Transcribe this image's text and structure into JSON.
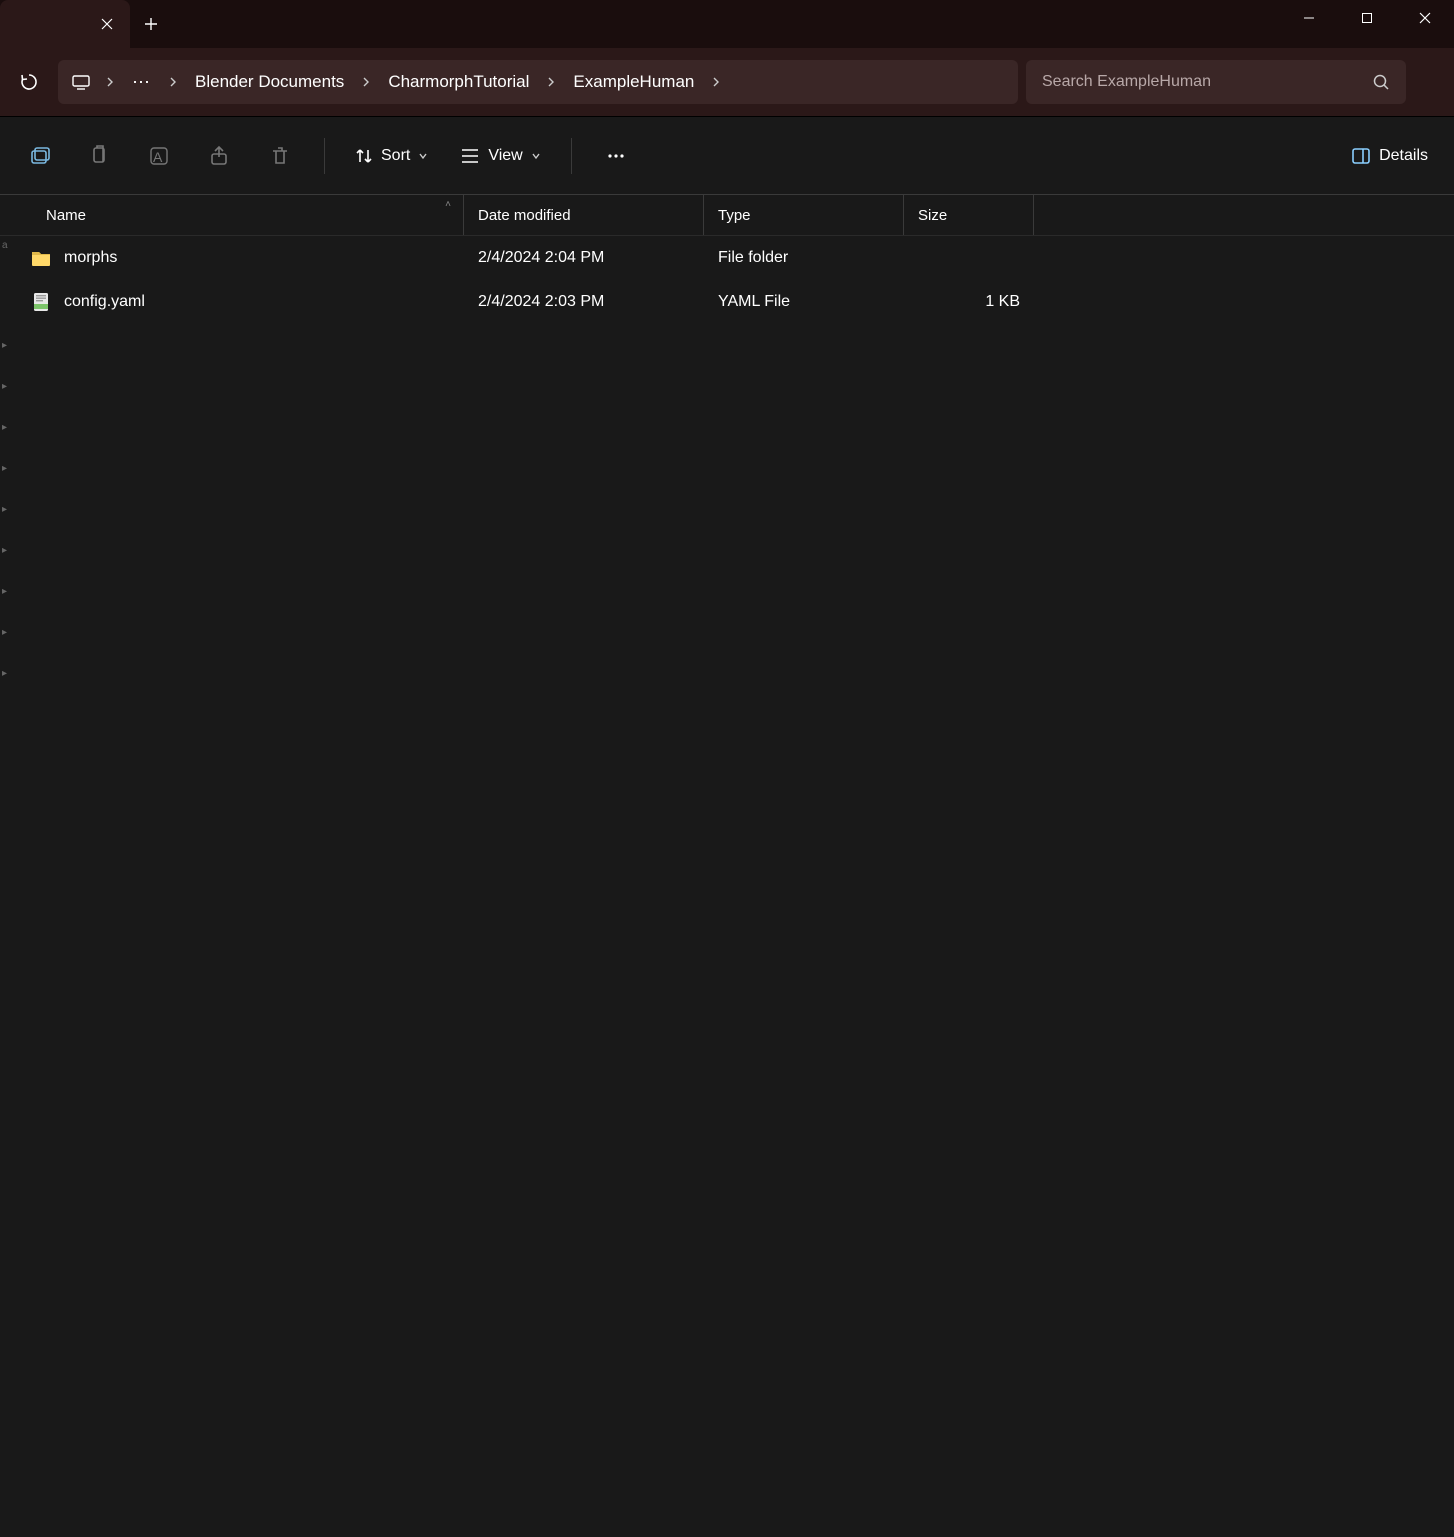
{
  "titlebar": {
    "tab_title": "",
    "new_tab_tooltip": "New tab"
  },
  "breadcrumb": {
    "items": [
      "Blender Documents",
      "CharmorphTutorial",
      "ExampleHuman"
    ]
  },
  "search": {
    "placeholder": "Search ExampleHuman"
  },
  "commandbar": {
    "sort_label": "Sort",
    "view_label": "View",
    "details_label": "Details"
  },
  "columns": {
    "name": "Name",
    "date": "Date modified",
    "type": "Type",
    "size": "Size"
  },
  "files": [
    {
      "name": "morphs",
      "date": "2/4/2024 2:04 PM",
      "type": "File folder",
      "size": "",
      "icon": "folder"
    },
    {
      "name": "config.yaml",
      "date": "2/4/2024 2:03 PM",
      "type": "YAML File",
      "size": "1 KB",
      "icon": "yaml"
    }
  ],
  "sidebar_stub_letter": "a"
}
